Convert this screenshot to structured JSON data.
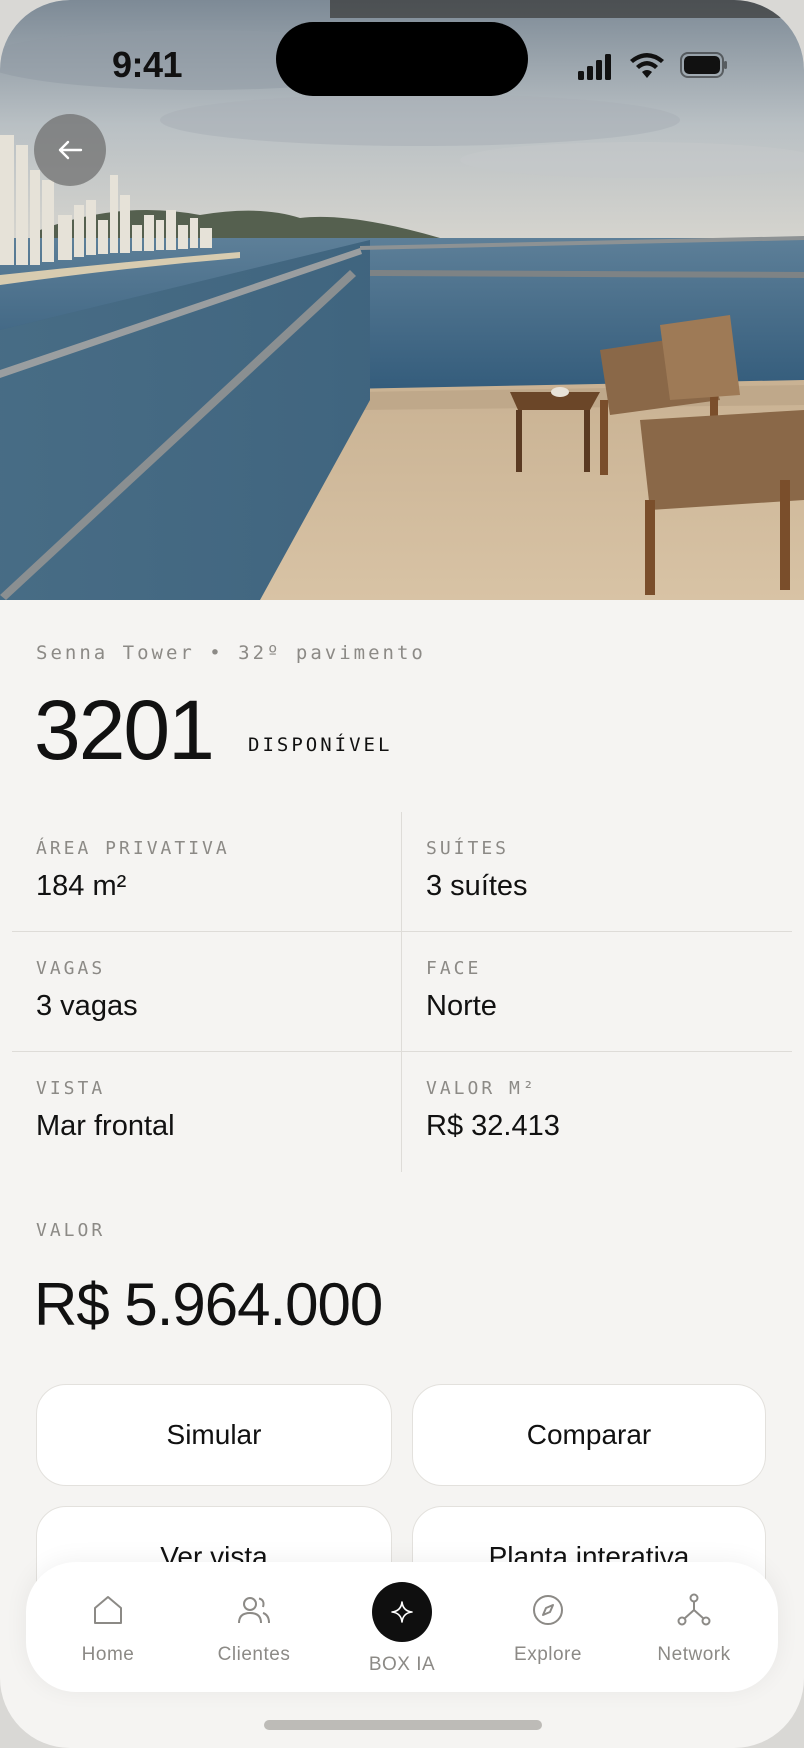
{
  "status_bar": {
    "time": "9:41"
  },
  "hero": {
    "back_icon": "arrow-left-icon"
  },
  "unit": {
    "subtitle": "Senna Tower • 32º pavimento",
    "number": "3201",
    "status": "DISPONÍVEL"
  },
  "specs": [
    {
      "label": "ÁREA PRIVATIVA",
      "value": "184 m²"
    },
    {
      "label": "SUÍTES",
      "value": "3 suítes"
    },
    {
      "label": "VAGAS",
      "value": "3 vagas"
    },
    {
      "label": "FACE",
      "value": "Norte"
    },
    {
      "label": "VISTA",
      "value": "Mar frontal"
    },
    {
      "label": "VALOR M²",
      "value": "R$ 32.413"
    }
  ],
  "price": {
    "label": "VALOR",
    "value": "R$ 5.964.000"
  },
  "actions": {
    "simulate": "Simular",
    "compare": "Comparar",
    "view": "Ver vista",
    "plan": "Planta interativa"
  },
  "tabs": [
    {
      "label": "Home",
      "icon": "home-icon"
    },
    {
      "label": "Clientes",
      "icon": "users-icon"
    },
    {
      "label": "BOX IA",
      "icon": "sparkle-icon"
    },
    {
      "label": "Explore",
      "icon": "compass-icon"
    },
    {
      "label": "Network",
      "icon": "network-icon"
    }
  ],
  "colors": {
    "background": "#f5f4f2",
    "muted_text": "#8c8a86",
    "primary_text": "#111111",
    "divider": "#dedcd8",
    "accent_dark": "#0f0f0f"
  }
}
